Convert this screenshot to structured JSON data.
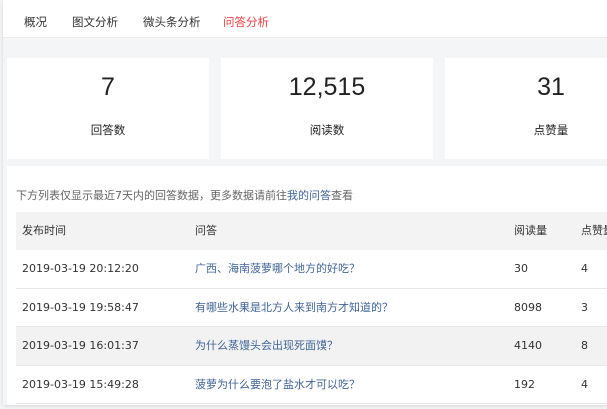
{
  "tabs": [
    {
      "label": "概况"
    },
    {
      "label": "图文分析"
    },
    {
      "label": "微头条分析"
    },
    {
      "label": "问答分析"
    }
  ],
  "active_tab_color": "#f04142",
  "stats": [
    {
      "value": "7",
      "label": "回答数"
    },
    {
      "value": "12,515",
      "label": "阅读数"
    },
    {
      "value": "31",
      "label": "点赞量"
    }
  ],
  "notice": {
    "prefix": "下方列表仅显示最近7天内的回答数据，更多数据请前往",
    "link": "我的问答",
    "suffix": "查看"
  },
  "table": {
    "headers": [
      "发布时间",
      "问答",
      "阅读量",
      "点赞量"
    ],
    "rows": [
      {
        "time": "2019-03-19 20:12:20",
        "question": "广西、海南菠萝哪个地方的好吃？",
        "reads": "30",
        "likes": "4"
      },
      {
        "time": "2019-03-19 19:58:47",
        "question": "有哪些水果是北方人来到南方才知道的？",
        "reads": "8098",
        "likes": "3"
      },
      {
        "time": "2019-03-19 16:01:37",
        "question": "为什么蒸馒头会出现死面馍？",
        "reads": "4140",
        "likes": "8"
      },
      {
        "time": "2019-03-19 15:49:28",
        "question": "菠萝为什么要泡了盐水才可以吃？",
        "reads": "192",
        "likes": "4"
      }
    ]
  },
  "link_color": "#406599"
}
